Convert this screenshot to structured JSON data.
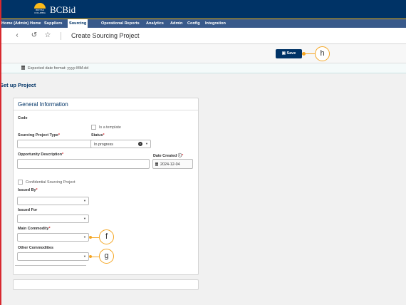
{
  "brand": {
    "crest_text": "BRITISH COLUMBIA",
    "name": "BCBid"
  },
  "nav": {
    "items": [
      {
        "label": "Home (Admin)"
      },
      {
        "label": "Home"
      },
      {
        "label": "Suppliers"
      },
      {
        "label": "Sourcing"
      },
      {
        "label": "Operational Reports"
      },
      {
        "label": "Analytics"
      },
      {
        "label": "Admin"
      },
      {
        "label": "Config"
      },
      {
        "label": "Integration"
      }
    ],
    "active": "Sourcing"
  },
  "toolbar": {
    "back_icon": "‹",
    "history_icon": "↺",
    "star_icon": "☆",
    "title": "Create Sourcing Project"
  },
  "actions": {
    "save_icon": "▣",
    "save_label": "Save",
    "callout_h": "h"
  },
  "hint": {
    "date_format": "Expected date format: yyyy-MM-dd"
  },
  "section": {
    "title": "Set up Project"
  },
  "card": {
    "title": "General Information",
    "code_label": "Code",
    "template_label": "Is a template",
    "type_label": "Sourcing Project Type",
    "status_label": "Status",
    "status_value": "In progress",
    "description_label": "Opportunity Description",
    "date_created_label": "Date Created",
    "info_icon": "ⓘ",
    "date_created_value": "2024-12-04",
    "confidential_label": "Confidential Sourcing Project",
    "issued_by_label": "Issued By",
    "issued_for_label": "Issued For",
    "main_commodity_label": "Main Commodity",
    "other_commodities_label": "Other Commodities",
    "required_mark": "*",
    "caret": "▼",
    "clear": "×",
    "callout_f": "f",
    "callout_g": "g"
  },
  "colors": {
    "brand_blue": "#003366",
    "nav_blue": "#38598a",
    "accent_gold": "#fcba19",
    "callout_orange": "#f5a623",
    "error_red": "#d8292f"
  }
}
